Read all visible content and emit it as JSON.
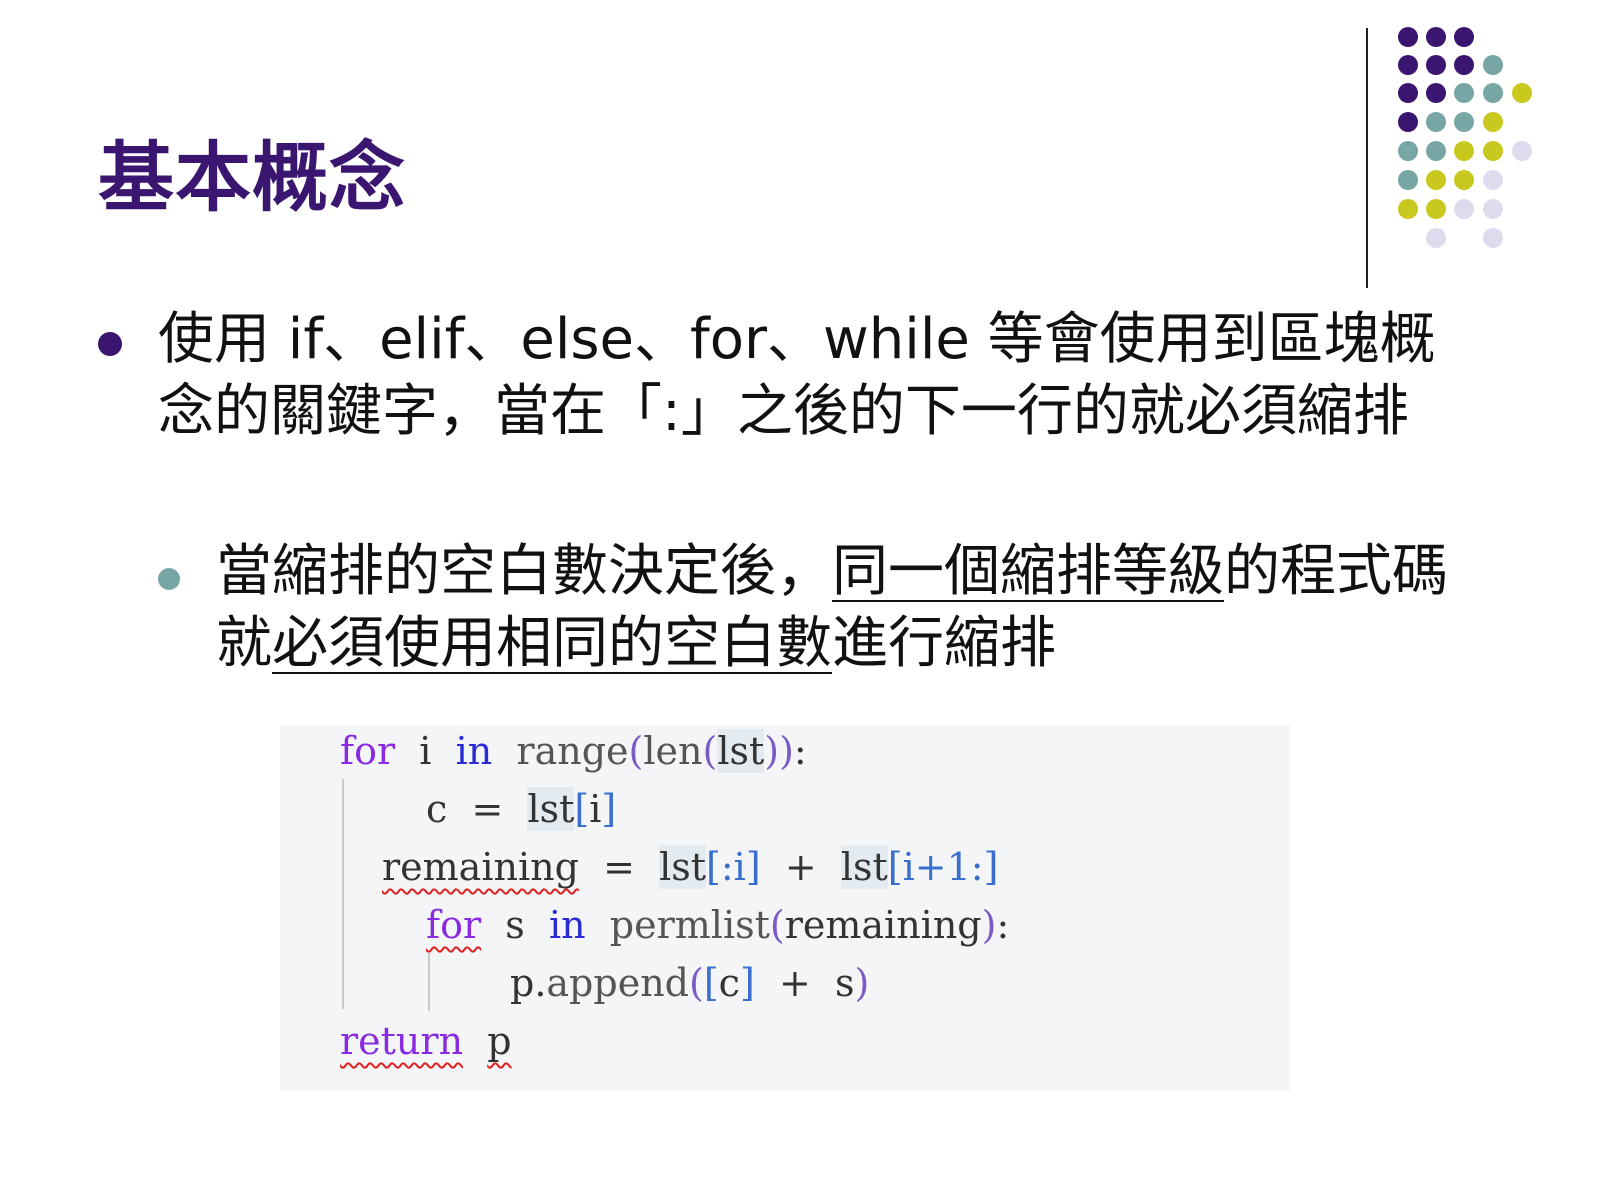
{
  "title": "基本概念",
  "bullet1": {
    "text": "使用 if、elif、else、for、while 等會使用到區塊概念的關鍵字，當在「:」之後的下一行的就必須縮排"
  },
  "bullet2": {
    "part1": "當縮排的空白數決定後，",
    "part2_underlined": "同一個縮排等級",
    "part3": "的程式碼就",
    "part4_underlined": "必須使用相同的空白數",
    "part5": "進行縮排"
  },
  "code": {
    "l1": {
      "kw": "for",
      "var": "i",
      "in": "in",
      "fn1": "range",
      "p1": "(",
      "fn2": "len",
      "p2": "(",
      "arg": "lst",
      "p3": "))",
      "colon": ":"
    },
    "l2": {
      "var": "c",
      "eq": "=",
      "obj": "lst",
      "lb": "[",
      "idx": "i",
      "rb": "]"
    },
    "l3": {
      "var": "remaining",
      "eq": "=",
      "obj1": "lst",
      "s1": "[:i]",
      "plus": "+",
      "obj2": "lst",
      "s2": "[i+1:]"
    },
    "l4": {
      "kw": "for",
      "var": "s",
      "in": "in",
      "fn": "permlist",
      "lp": "(",
      "arg": "remaining",
      "rp": ")",
      "colon": ":"
    },
    "l5": {
      "obj": "p.",
      "fn": "append",
      "lp": "(",
      "lb": "[",
      "arg": "c",
      "rb": "]",
      "plus": "+",
      "var": "s",
      "rp": ")"
    },
    "l6": {
      "kw": "return",
      "var": "p"
    }
  },
  "colors": {
    "title": "#3b1670",
    "dot_purple": "#3b1670",
    "dot_teal": "#78a6a4",
    "dot_yellow": "#c8c81e",
    "dot_lavender": "#dcdcee"
  }
}
